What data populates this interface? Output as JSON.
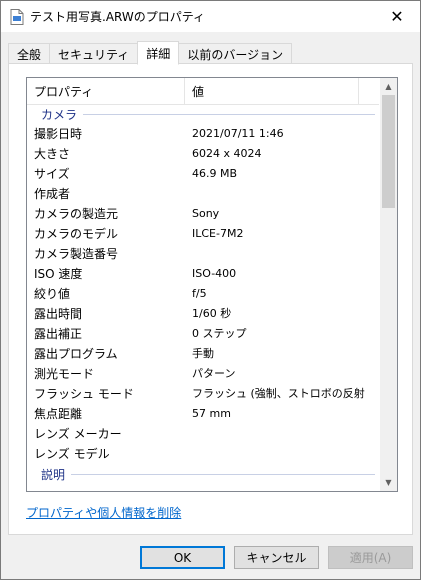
{
  "window": {
    "title": "テスト用写真.ARWのプロパティ",
    "close_symbol": "✕"
  },
  "tabs": [
    {
      "label": "全般"
    },
    {
      "label": "セキュリティ"
    },
    {
      "label": "詳細",
      "active": true
    },
    {
      "label": "以前のバージョン"
    }
  ],
  "list": {
    "col_property": "プロパティ",
    "col_value": "値",
    "groups": [
      {
        "label": "カメラ"
      },
      {
        "label": "説明"
      }
    ],
    "rows": [
      {
        "property": "撮影日時",
        "value": "2021/07/11 1:46"
      },
      {
        "property": "大きさ",
        "value": "6024 x 4024"
      },
      {
        "property": "サイズ",
        "value": "46.9 MB"
      },
      {
        "property": "作成者",
        "value": ""
      },
      {
        "property": "カメラの製造元",
        "value": "Sony"
      },
      {
        "property": "カメラのモデル",
        "value": "ILCE-7M2"
      },
      {
        "property": "カメラ製造番号",
        "value": ""
      },
      {
        "property": "ISO 速度",
        "value": "ISO-400"
      },
      {
        "property": "絞り値",
        "value": "f/5"
      },
      {
        "property": "露出時間",
        "value": "1/60 秒"
      },
      {
        "property": "露出補正",
        "value": "0 ステップ"
      },
      {
        "property": "露出プログラム",
        "value": "手動"
      },
      {
        "property": "測光モード",
        "value": "パターン"
      },
      {
        "property": "フラッシュ モード",
        "value": "フラッシュ (強制、ストロボの反射..."
      },
      {
        "property": "焦点距離",
        "value": "57 mm"
      },
      {
        "property": "レンズ メーカー",
        "value": ""
      },
      {
        "property": "レンズ モデル",
        "value": ""
      }
    ]
  },
  "remove_link": "プロパティや個人情報を削除",
  "buttons": {
    "ok": "OK",
    "cancel": "キャンセル",
    "apply": "適用(A)"
  },
  "icons": {
    "title_icon": "document-icon",
    "scroll_up": "▲",
    "scroll_down": "▼"
  }
}
